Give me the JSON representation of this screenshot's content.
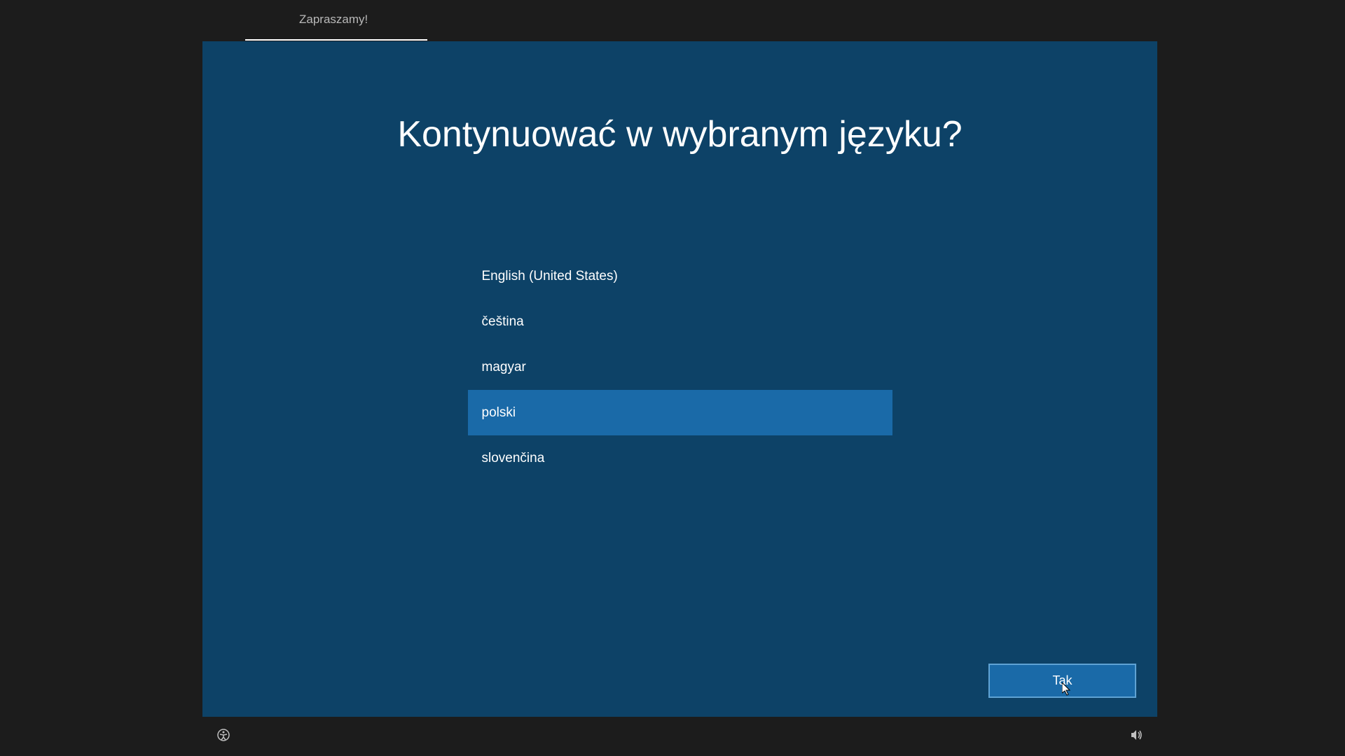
{
  "tab": {
    "label": "Zapraszamy!"
  },
  "title": "Kontynuować w wybranym języku?",
  "languages": [
    {
      "label": "English (United States)",
      "selected": false
    },
    {
      "label": "čeština",
      "selected": false
    },
    {
      "label": "magyar",
      "selected": false
    },
    {
      "label": "polski",
      "selected": true
    },
    {
      "label": "slovenčina",
      "selected": false
    }
  ],
  "confirm_button": {
    "label": "Tak"
  },
  "icons": {
    "accessibility": "accessibility-icon",
    "volume": "volume-icon"
  }
}
